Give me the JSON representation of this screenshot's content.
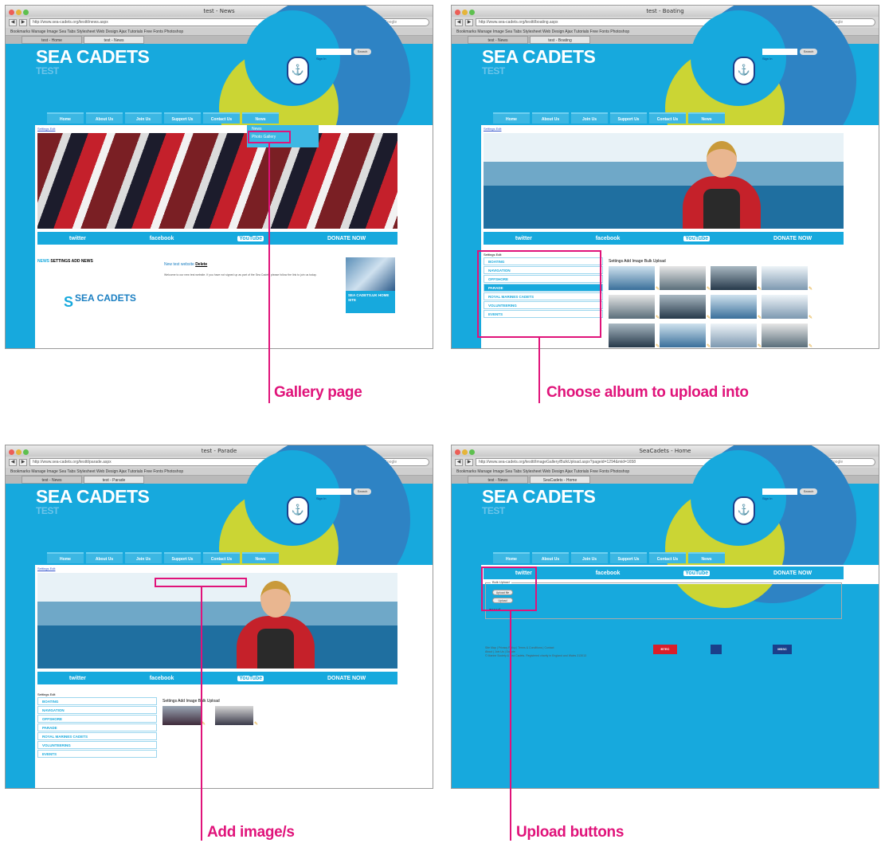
{
  "callouts": {
    "c1": "Gallery page",
    "c2": "Choose album to upload into",
    "c3": "Add image/s",
    "c4": "Upload buttons"
  },
  "colors": {
    "accent": "#e0137a",
    "site_blue": "#17a9dd",
    "lime": "#cbd534"
  },
  "site": {
    "logo": "SEA CADETS",
    "logo_sub": "TEST",
    "nav": [
      "Home",
      "About Us",
      "Join Us",
      "Support Us",
      "Contact Us",
      "News"
    ],
    "social": [
      "twitter",
      "facebook",
      "YouTube",
      "DONATE NOW"
    ]
  },
  "p1": {
    "title": "test - News",
    "url": "http://www.sea-cadets.org/testtt/news.aspx",
    "dropdown": [
      "News",
      "Photo Gallery"
    ],
    "crumbs": "Settings Edit",
    "news_header": "NEWS",
    "news_actions": "SETTINGS ADD NEWS",
    "news_title": "New test website",
    "news_link": "Delete",
    "news_body": "Welcome to our new test website. If you have not signed up as part of the Sea Cadets please follow the link to join us today.",
    "promo": "SEA CADETS.UK HOME SITE",
    "logo_small": "SEA CADETS"
  },
  "p2": {
    "title": "test - Boating",
    "url": "http://www.sea-cadets.org/testtt/boating.aspx",
    "crumbs": "Settings Edit",
    "album_hdr": "Settings Edit",
    "albums": [
      "BOATING",
      "NAVIGATION",
      "OFFSHORE",
      "PARADE",
      "ROYAL MARINES CADETS",
      "VOLUNTEERING",
      "EVENTS"
    ],
    "grid_hdr": "Settings Add Image Bulk Upload"
  },
  "p3": {
    "title": "test - Parade",
    "url": "http://www.sea-cadets.org/testtt/parade.aspx",
    "crumbs": "Settings Edit",
    "album_hdr": "Settings Edit",
    "albums": [
      "BOATING",
      "NAVIGATION",
      "OFFSHORE",
      "PARADE",
      "ROYAL MARINES CADETS",
      "VOLUNTEERING",
      "EVENTS"
    ],
    "grid_hdr": "Settings Add Image Bulk Upload"
  },
  "p4": {
    "title": "SeaCadets - Home",
    "url": "http://www.sea-cadets.org/testtt/ImageGallery/BulkUpload.aspx?pageid=1294&mid=1658",
    "legend": "Bulk Upload",
    "btn1": "Upload file",
    "btn2": "Upload",
    "cancel": "Cancel",
    "footer1": "Site Map | Privacy Policy | Terms & Conditions | Contact",
    "footer2": "About | Join Us | Donate",
    "footer3": "© Marine Society & Sea Cadets. Registered charity in England and Wales 313013"
  },
  "browser": {
    "bookmarks": "Bookmarks   Manage Image   Sea Tabs Stylesheet   Web Design   Ajax Tutorials   Free Fonts   Photoshop",
    "search_placeholder": "Google"
  }
}
